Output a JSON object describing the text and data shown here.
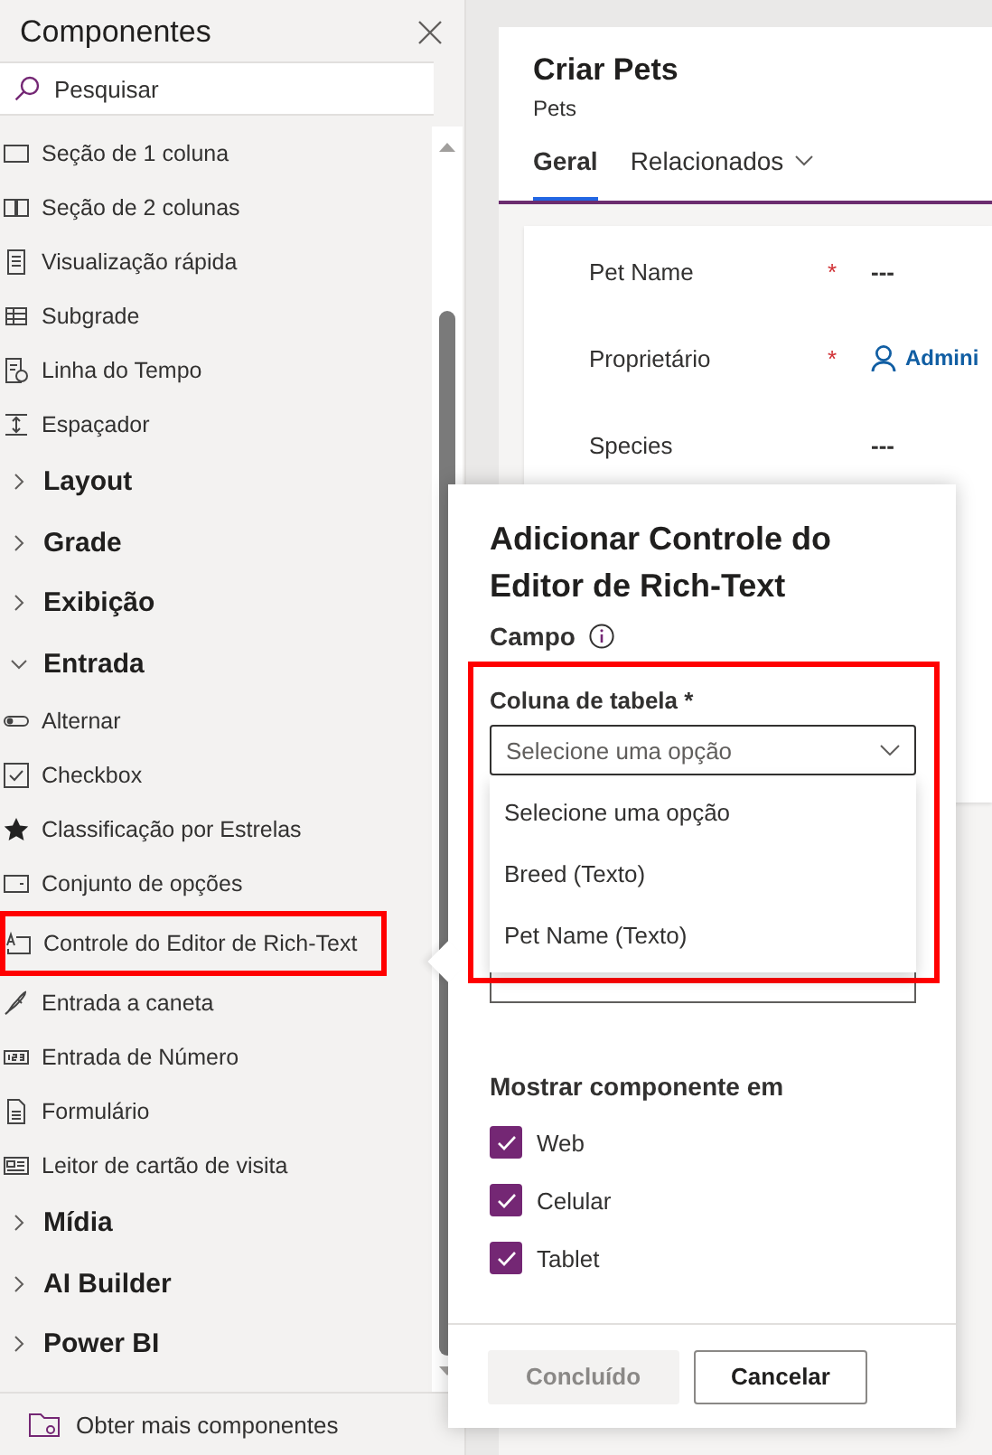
{
  "sidebar": {
    "title": "Componentes",
    "search": {
      "placeholder": "Pesquisar"
    },
    "items": [
      {
        "kind": "component",
        "label": "Seção de 1 coluna",
        "highlighted": false
      },
      {
        "kind": "component",
        "label": "Seção de 2 colunas",
        "highlighted": false
      },
      {
        "kind": "component",
        "label": "Visualização rápida",
        "highlighted": false
      },
      {
        "kind": "component",
        "label": "Subgrade",
        "highlighted": false
      },
      {
        "kind": "component",
        "label": "Linha do Tempo",
        "highlighted": false
      },
      {
        "kind": "component",
        "label": "Espaçador",
        "highlighted": false
      },
      {
        "kind": "group",
        "label": "Layout",
        "expanded": false
      },
      {
        "kind": "group",
        "label": "Grade",
        "expanded": false
      },
      {
        "kind": "group",
        "label": "Exibição",
        "expanded": false
      },
      {
        "kind": "group",
        "label": "Entrada",
        "expanded": true,
        "children": [
          {
            "label": "Alternar",
            "highlighted": false
          },
          {
            "label": "Checkbox",
            "highlighted": false
          },
          {
            "label": "Classificação por Estrelas",
            "highlighted": false
          },
          {
            "label": "Conjunto de opções",
            "highlighted": false
          },
          {
            "label": "Controle do Editor de Rich-Text",
            "highlighted": true
          },
          {
            "label": "Entrada a caneta",
            "highlighted": false
          },
          {
            "label": "Entrada de Número",
            "highlighted": false
          },
          {
            "label": "Formulário",
            "highlighted": false
          },
          {
            "label": "Leitor de cartão de visita",
            "highlighted": false
          }
        ]
      },
      {
        "kind": "group",
        "label": "Mídia",
        "expanded": false
      },
      {
        "kind": "group",
        "label": "AI Builder",
        "expanded": false
      },
      {
        "kind": "group",
        "label": "Power BI",
        "expanded": false
      }
    ],
    "footer_link": "Obter mais componentes"
  },
  "form": {
    "title": "Criar Pets",
    "entity": "Pets",
    "tabs": [
      {
        "label": "Geral",
        "selected": true
      },
      {
        "label": "Relacionados",
        "selected": false
      }
    ],
    "fields": [
      {
        "kind": "text",
        "label": "Pet Name",
        "required_mark": "*",
        "value": "---"
      },
      {
        "kind": "lookup",
        "label": "Proprietário",
        "required_mark": "*",
        "value": "Admini"
      },
      {
        "kind": "text",
        "label": "Species",
        "value": "---"
      }
    ]
  },
  "dialog": {
    "title": "Adicionar Controle do Editor de Rich-Text",
    "section": "Campo",
    "column_field": {
      "label": "Coluna de tabela *",
      "highlighted": true,
      "placeholder": "Selecione uma opção",
      "expanded": true,
      "options": [
        "Selecione uma opção",
        "Breed (Texto)",
        "Pet Name (Texto)"
      ]
    },
    "show_in": {
      "label": "Mostrar componente em",
      "checkboxes": [
        {
          "label": "Web",
          "checked": true
        },
        {
          "label": "Celular",
          "checked": true
        },
        {
          "label": "Tablet",
          "checked": true
        }
      ]
    },
    "buttons": [
      {
        "label": "Concluído",
        "disabled": true
      },
      {
        "label": "Cancelar",
        "disabled": false
      }
    ]
  }
}
